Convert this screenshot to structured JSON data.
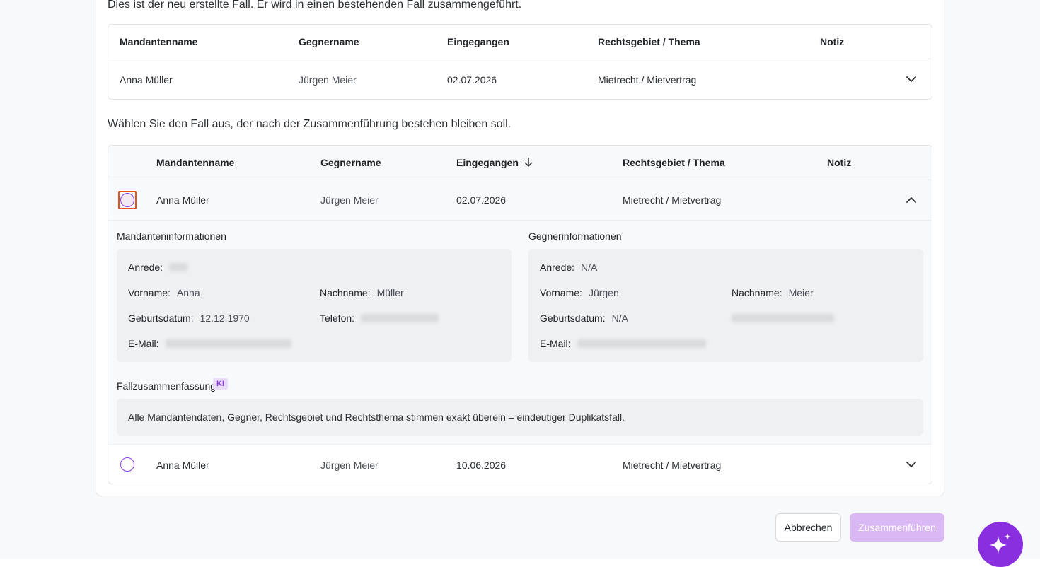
{
  "intro_text": "Dies ist der neu erstellte Fall. Er wird in einen bestehenden Fall zusammengeführt.",
  "new_case_table": {
    "headers": {
      "client": "Mandantenname",
      "opponent": "Gegnername",
      "received": "Eingegangen",
      "area": "Rechtsgebiet / Thema",
      "note": "Notiz"
    },
    "row": {
      "client": "Anna Müller",
      "opponent": "Jürgen Meier",
      "received": "02.07.2026",
      "area": "Mietrecht / Mietvertrag"
    }
  },
  "select_text": "Wählen Sie den Fall aus, der nach der Zusammenführung bestehen bleiben soll.",
  "existing_table": {
    "headers": {
      "client": "Mandantenname",
      "opponent": "Gegnername",
      "received": "Eingegangen",
      "area": "Rechtsgebiet / Thema",
      "note": "Notiz"
    },
    "rows": [
      {
        "client": "Anna Müller",
        "opponent": "Jürgen Meier",
        "received": "02.07.2026",
        "area": "Mietrecht / Mietvertrag"
      },
      {
        "client": "Anna Müller",
        "opponent": "Jürgen Meier",
        "received": "10.06.2026",
        "area": "Mietrecht / Mietvertrag"
      }
    ]
  },
  "details": {
    "client_title": "Mandanteninformationen",
    "opponent_title": "Gegnerinformationen",
    "client": {
      "salutation_label": "Anrede:",
      "firstname_label": "Vorname:",
      "firstname": "Anna",
      "lastname_label": "Nachname:",
      "lastname": "Müller",
      "birthdate_label": "Geburtsdatum:",
      "birthdate": "12.12.1970",
      "phone_label": "Telefon:",
      "email_label": "E-Mail:"
    },
    "opponent": {
      "salutation_label": "Anrede:",
      "salutation": "N/A",
      "firstname_label": "Vorname:",
      "firstname": "Jürgen",
      "lastname_label": "Nachname:",
      "lastname": "Meier",
      "birthdate_label": "Geburtsdatum:",
      "birthdate": "N/A",
      "email_label": "E-Mail:"
    },
    "summary_title": "Fallzusammenfassung",
    "summary_badge": "KI",
    "summary_text": "Alle Mandantendaten, Gegner, Rechtsgebiet und Rechtsthema stimmen exakt überein – eindeutiger Duplikatsfall."
  },
  "buttons": {
    "cancel": "Abbrechen",
    "merge": "Zusammenführen"
  },
  "icons": {
    "chevron_down": "chevron-down-icon",
    "chevron_up": "chevron-up-icon",
    "sort_arrow": "arrow-down-icon",
    "fab": "sparkles-icon"
  },
  "colors": {
    "accent": "#8a2fe0",
    "focus_outline": "#e0521e",
    "merge_disabled": "#d9b8f3"
  }
}
